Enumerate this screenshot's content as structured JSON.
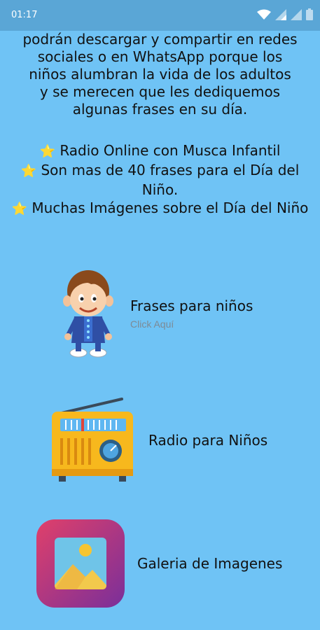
{
  "status": {
    "time": "01:17"
  },
  "intro": {
    "lines": [
      "podrán descargar y compartir en redes",
      "sociales o en WhatsApp porque los",
      "niños alumbran la vida de los adultos",
      "y se merecen que les dediquemos",
      "algunas frases en su día."
    ]
  },
  "features": [
    "Radio Online con Musca Infantil",
    "Son mas de 40 frases para el Día del Niño.",
    "Muchas Imágenes sobre el Día del Niño"
  ],
  "menu": {
    "frases": {
      "label": "Frases para niños",
      "sub": "Click Aquí"
    },
    "radio": {
      "label": "Radio para Niños"
    },
    "galeria": {
      "label": "Galeria de Imagenes"
    }
  },
  "icons": {
    "star": "star-icon",
    "kid": "kid-icon",
    "radio": "radio-icon",
    "gallery": "gallery-icon"
  }
}
